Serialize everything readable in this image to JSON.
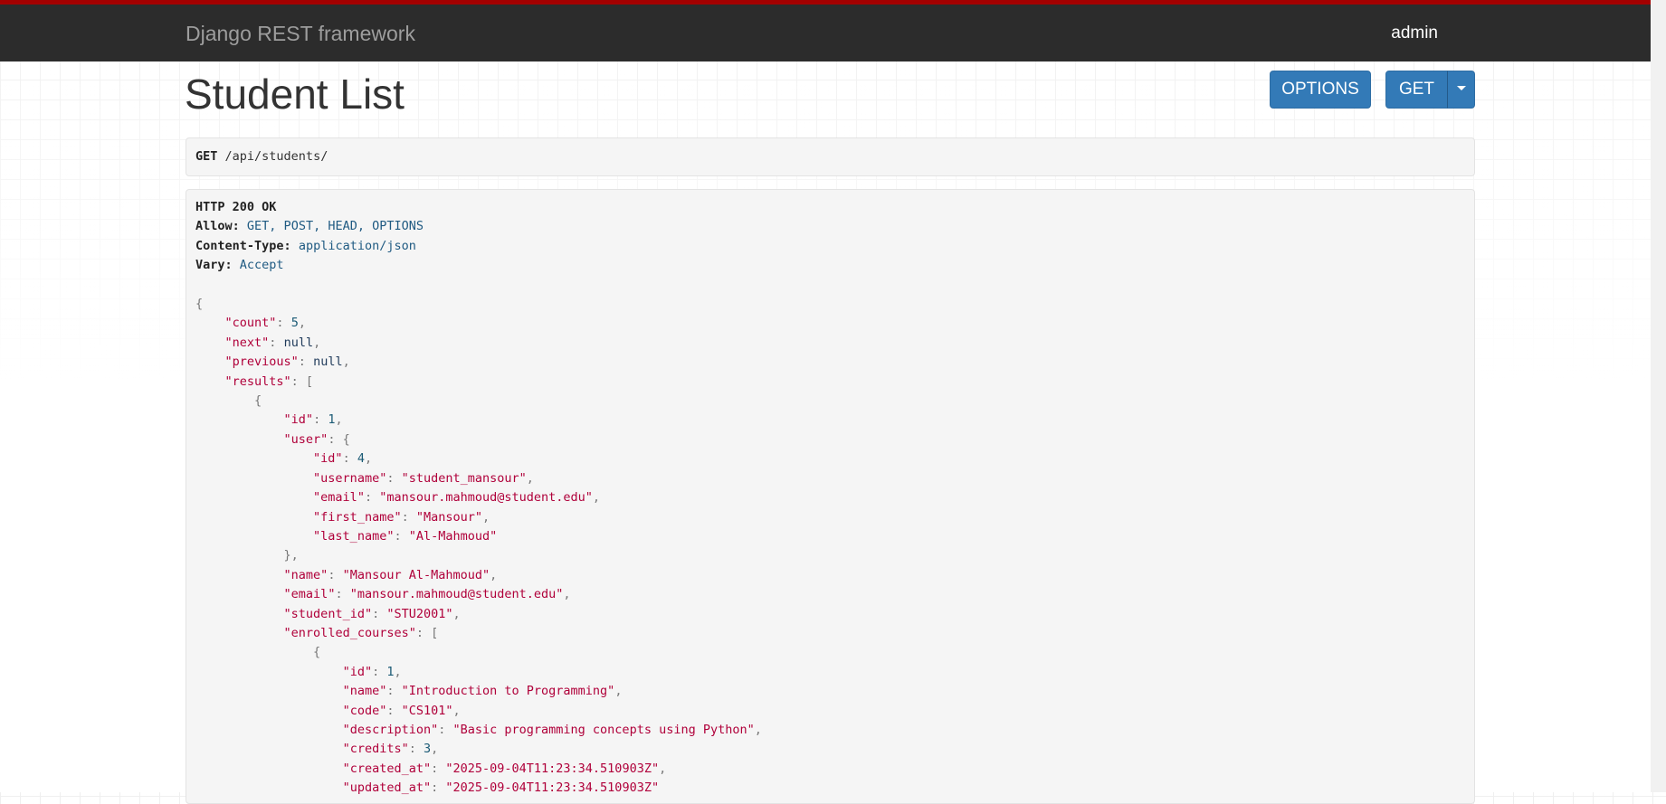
{
  "navbar": {
    "brand": "Django REST framework",
    "user": "admin"
  },
  "page": {
    "title": "Student List"
  },
  "buttons": {
    "options": "OPTIONS",
    "get": "GET"
  },
  "request": {
    "method": "GET",
    "path": "/api/students/"
  },
  "response": {
    "status": "HTTP 200 OK",
    "headers": [
      {
        "name": "Allow:",
        "value": "GET, POST, HEAD, OPTIONS"
      },
      {
        "name": "Content-Type:",
        "value": "application/json"
      },
      {
        "name": "Vary:",
        "value": "Accept"
      }
    ]
  },
  "json_lines": [
    {
      "indent": 0,
      "parts": [
        {
          "t": "p",
          "v": "{"
        }
      ]
    },
    {
      "indent": 1,
      "parts": [
        {
          "t": "k",
          "v": "\"count\""
        },
        {
          "t": "p",
          "v": ": "
        },
        {
          "t": "n",
          "v": "5"
        },
        {
          "t": "p",
          "v": ","
        }
      ]
    },
    {
      "indent": 1,
      "parts": [
        {
          "t": "k",
          "v": "\"next\""
        },
        {
          "t": "p",
          "v": ": "
        },
        {
          "t": "lit",
          "v": "null"
        },
        {
          "t": "p",
          "v": ","
        }
      ]
    },
    {
      "indent": 1,
      "parts": [
        {
          "t": "k",
          "v": "\"previous\""
        },
        {
          "t": "p",
          "v": ": "
        },
        {
          "t": "lit",
          "v": "null"
        },
        {
          "t": "p",
          "v": ","
        }
      ]
    },
    {
      "indent": 1,
      "parts": [
        {
          "t": "k",
          "v": "\"results\""
        },
        {
          "t": "p",
          "v": ": ["
        }
      ]
    },
    {
      "indent": 2,
      "parts": [
        {
          "t": "p",
          "v": "{"
        }
      ]
    },
    {
      "indent": 3,
      "parts": [
        {
          "t": "k",
          "v": "\"id\""
        },
        {
          "t": "p",
          "v": ": "
        },
        {
          "t": "n",
          "v": "1"
        },
        {
          "t": "p",
          "v": ","
        }
      ]
    },
    {
      "indent": 3,
      "parts": [
        {
          "t": "k",
          "v": "\"user\""
        },
        {
          "t": "p",
          "v": ": {"
        }
      ]
    },
    {
      "indent": 4,
      "parts": [
        {
          "t": "k",
          "v": "\"id\""
        },
        {
          "t": "p",
          "v": ": "
        },
        {
          "t": "n",
          "v": "4"
        },
        {
          "t": "p",
          "v": ","
        }
      ]
    },
    {
      "indent": 4,
      "parts": [
        {
          "t": "k",
          "v": "\"username\""
        },
        {
          "t": "p",
          "v": ": "
        },
        {
          "t": "s",
          "v": "\"student_mansour\""
        },
        {
          "t": "p",
          "v": ","
        }
      ]
    },
    {
      "indent": 4,
      "parts": [
        {
          "t": "k",
          "v": "\"email\""
        },
        {
          "t": "p",
          "v": ": "
        },
        {
          "t": "s",
          "v": "\"mansour.mahmoud@student.edu\""
        },
        {
          "t": "p",
          "v": ","
        }
      ]
    },
    {
      "indent": 4,
      "parts": [
        {
          "t": "k",
          "v": "\"first_name\""
        },
        {
          "t": "p",
          "v": ": "
        },
        {
          "t": "s",
          "v": "\"Mansour\""
        },
        {
          "t": "p",
          "v": ","
        }
      ]
    },
    {
      "indent": 4,
      "parts": [
        {
          "t": "k",
          "v": "\"last_name\""
        },
        {
          "t": "p",
          "v": ": "
        },
        {
          "t": "s",
          "v": "\"Al-Mahmoud\""
        }
      ]
    },
    {
      "indent": 3,
      "parts": [
        {
          "t": "p",
          "v": "},"
        }
      ]
    },
    {
      "indent": 3,
      "parts": [
        {
          "t": "k",
          "v": "\"name\""
        },
        {
          "t": "p",
          "v": ": "
        },
        {
          "t": "s",
          "v": "\"Mansour Al-Mahmoud\""
        },
        {
          "t": "p",
          "v": ","
        }
      ]
    },
    {
      "indent": 3,
      "parts": [
        {
          "t": "k",
          "v": "\"email\""
        },
        {
          "t": "p",
          "v": ": "
        },
        {
          "t": "s",
          "v": "\"mansour.mahmoud@student.edu\""
        },
        {
          "t": "p",
          "v": ","
        }
      ]
    },
    {
      "indent": 3,
      "parts": [
        {
          "t": "k",
          "v": "\"student_id\""
        },
        {
          "t": "p",
          "v": ": "
        },
        {
          "t": "s",
          "v": "\"STU2001\""
        },
        {
          "t": "p",
          "v": ","
        }
      ]
    },
    {
      "indent": 3,
      "parts": [
        {
          "t": "k",
          "v": "\"enrolled_courses\""
        },
        {
          "t": "p",
          "v": ": ["
        }
      ]
    },
    {
      "indent": 4,
      "parts": [
        {
          "t": "p",
          "v": "{"
        }
      ]
    },
    {
      "indent": 5,
      "parts": [
        {
          "t": "k",
          "v": "\"id\""
        },
        {
          "t": "p",
          "v": ": "
        },
        {
          "t": "n",
          "v": "1"
        },
        {
          "t": "p",
          "v": ","
        }
      ]
    },
    {
      "indent": 5,
      "parts": [
        {
          "t": "k",
          "v": "\"name\""
        },
        {
          "t": "p",
          "v": ": "
        },
        {
          "t": "s",
          "v": "\"Introduction to Programming\""
        },
        {
          "t": "p",
          "v": ","
        }
      ]
    },
    {
      "indent": 5,
      "parts": [
        {
          "t": "k",
          "v": "\"code\""
        },
        {
          "t": "p",
          "v": ": "
        },
        {
          "t": "s",
          "v": "\"CS101\""
        },
        {
          "t": "p",
          "v": ","
        }
      ]
    },
    {
      "indent": 5,
      "parts": [
        {
          "t": "k",
          "v": "\"description\""
        },
        {
          "t": "p",
          "v": ": "
        },
        {
          "t": "s",
          "v": "\"Basic programming concepts using Python\""
        },
        {
          "t": "p",
          "v": ","
        }
      ]
    },
    {
      "indent": 5,
      "parts": [
        {
          "t": "k",
          "v": "\"credits\""
        },
        {
          "t": "p",
          "v": ": "
        },
        {
          "t": "n",
          "v": "3"
        },
        {
          "t": "p",
          "v": ","
        }
      ]
    },
    {
      "indent": 5,
      "parts": [
        {
          "t": "k",
          "v": "\"created_at\""
        },
        {
          "t": "p",
          "v": ": "
        },
        {
          "t": "s",
          "v": "\"2025-09-04T11:23:34.510903Z\""
        },
        {
          "t": "p",
          "v": ","
        }
      ]
    },
    {
      "indent": 5,
      "parts": [
        {
          "t": "k",
          "v": "\"updated_at\""
        },
        {
          "t": "p",
          "v": ": "
        },
        {
          "t": "s",
          "v": "\"2025-09-04T11:23:34.510903Z\""
        }
      ]
    }
  ]
}
